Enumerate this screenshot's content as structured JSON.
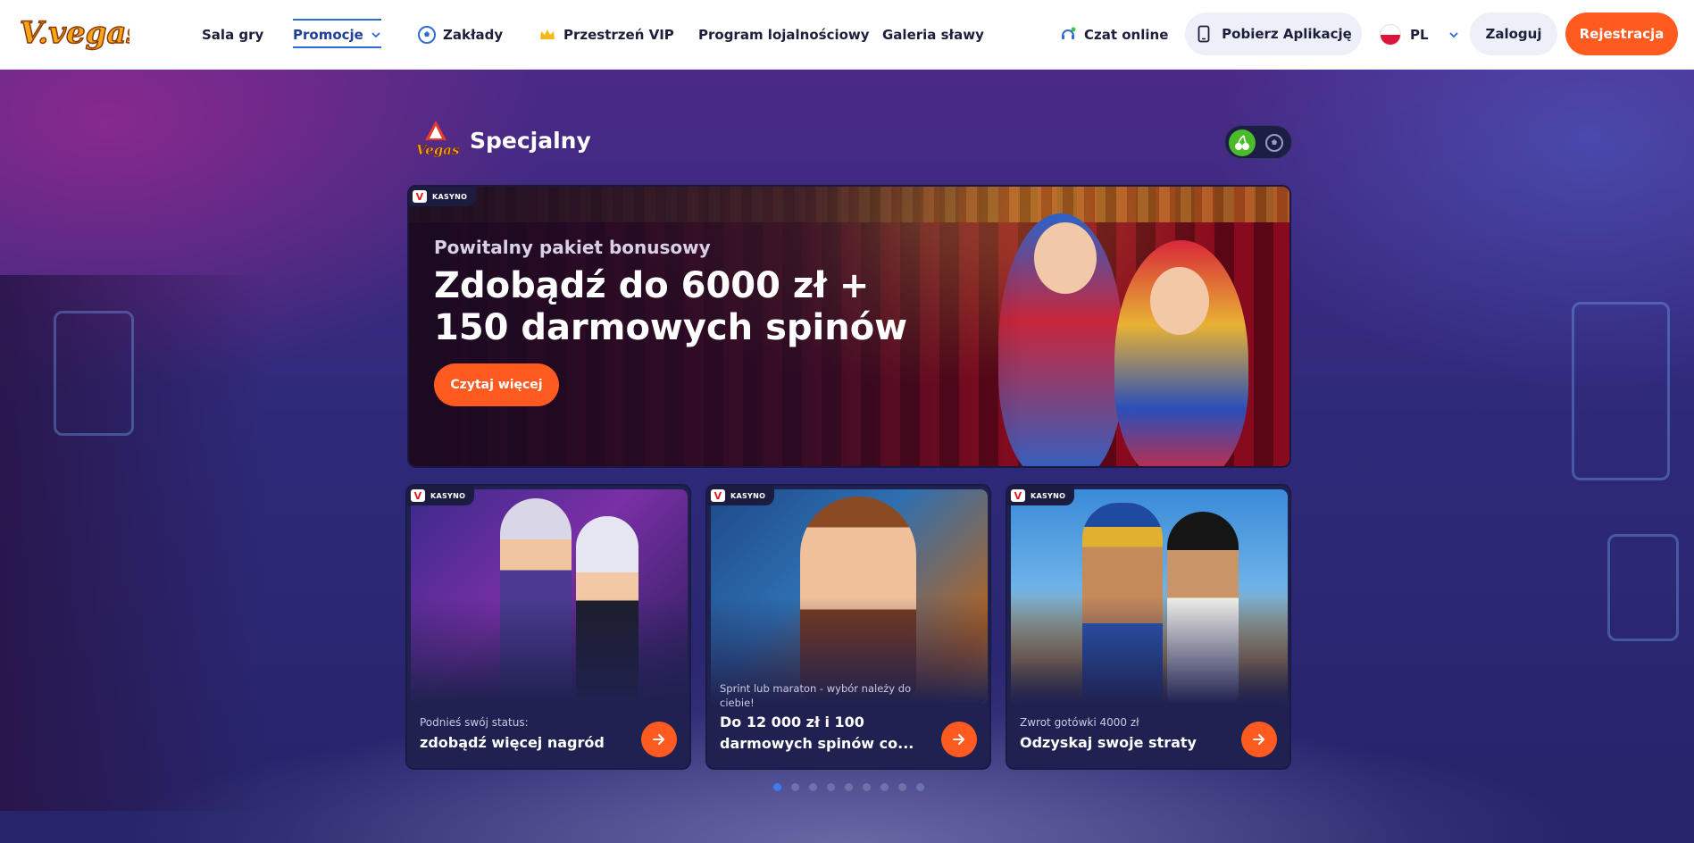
{
  "brand": {
    "logo_text": "V.vegas",
    "accent": "#ff5a1f",
    "link_blue": "#2f6bd8"
  },
  "nav": {
    "items": [
      {
        "label": "Sala gry"
      },
      {
        "label": "Promocje"
      },
      {
        "label": "Zakłady",
        "icon": "soccer-ball-icon"
      },
      {
        "label": "Przestrzeń VIP",
        "icon": "crown-icon"
      },
      {
        "label": "Program lojalnościowy"
      },
      {
        "label": "Galeria sławy"
      }
    ],
    "chat_label": "Czat online",
    "app_label": "Pobierz Aplikację",
    "language": "PL",
    "login_label": "Zaloguj",
    "register_label": "Rejestracja"
  },
  "section": {
    "logo_text": "Vegas",
    "title": "Specjalny",
    "toggle": {
      "active": "casino",
      "options": [
        "cherry-icon",
        "soccer-ball-icon"
      ]
    }
  },
  "hero": {
    "tag": "KASYNO",
    "subtitle": "Powitalny pakiet bonusowy",
    "title": "Zdobądź do 6000 zł + 150 darmowych spinów",
    "button": "Czytaj więcej"
  },
  "cards": [
    {
      "tag": "KASYNO",
      "subtitle": "Podnieś swój status:",
      "title": "zdobądź więcej nagród"
    },
    {
      "tag": "KASYNO",
      "subtitle": "Sprint lub maraton - wybór należy do ciebie!",
      "title": "Do 12 000 zł i 100",
      "title2": "darmowych spinów co..."
    },
    {
      "tag": "KASYNO",
      "subtitle": "Zwrot gotówki 4000 zł",
      "title": "Odzyskaj swoje straty"
    }
  ],
  "carousel": {
    "total": 9,
    "active": 1
  }
}
